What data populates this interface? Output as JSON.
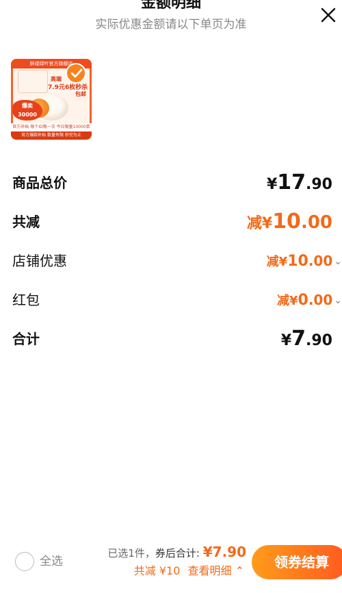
{
  "header": {
    "title": "金额明细",
    "subtitle": "实际优惠金额请以下单页为准"
  },
  "product": {
    "banner_top": "鲜咸绿叶官方旗舰店",
    "promo_line1": "高端",
    "promo_line2": "7.9元6枚秒杀",
    "promo_line3": "包邮",
    "burst_line1": "爆卖",
    "burst_line2": "30000",
    "stripe": "官方补贴 每个ID限一次 今日限量10000单",
    "banner_bottom": "官方爆款补贴 数量有限 秒完为止"
  },
  "rows": {
    "total": {
      "label": "商品总价",
      "currency": "¥",
      "int": "17",
      "dec": ".90"
    },
    "reduce": {
      "label": "共减",
      "prefix": "减¥",
      "int": "10",
      "dec": ".00"
    },
    "shop": {
      "label": "店铺优惠",
      "prefix": "减¥",
      "int": "10",
      "dec": ".00"
    },
    "redpacket": {
      "label": "红包",
      "prefix": "减¥",
      "int": "0",
      "dec": ".00"
    },
    "sum": {
      "label": "合计",
      "currency": "¥",
      "int": "7",
      "dec": ".90"
    }
  },
  "footer": {
    "select_all": "全选",
    "selected_count": "已选1件，",
    "after_coupon_label": "券后合计: ",
    "after_coupon_amount": "¥7.90",
    "reduce_text": "共减 ¥10",
    "view_detail": "查看明细",
    "checkout": "领券结算"
  },
  "colors": {
    "accent": "#f26a19",
    "checkout_gradient_start": "#ff9c1a",
    "checkout_gradient_end": "#ff5a1f"
  },
  "icons": {
    "close": "close-icon",
    "check": "check-icon",
    "chevron": "chevron-down-icon"
  }
}
